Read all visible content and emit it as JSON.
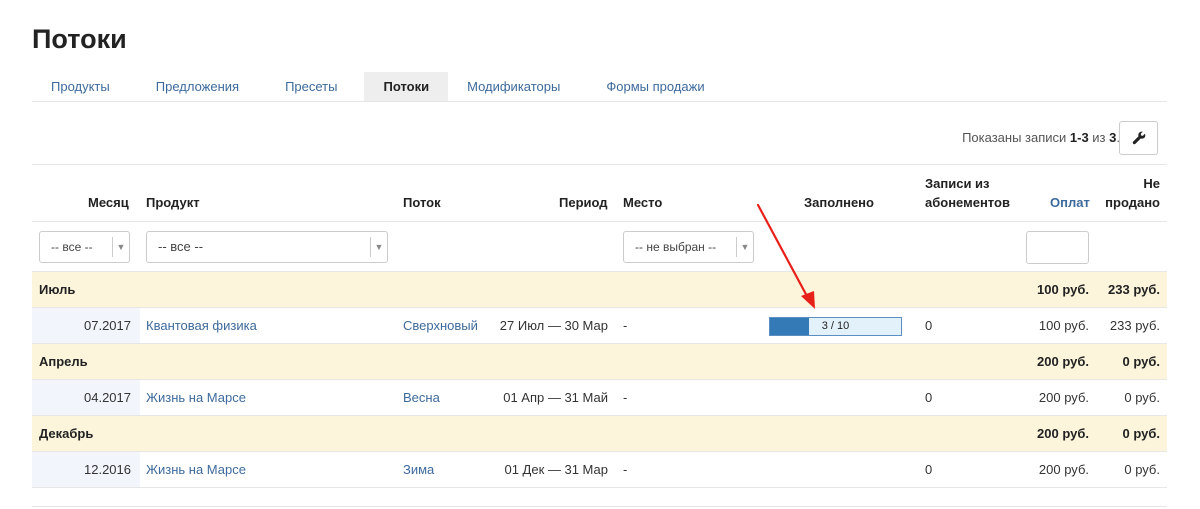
{
  "page": {
    "title": "Потоки"
  },
  "tabs": [
    {
      "label": "Продукты"
    },
    {
      "label": "Предложения"
    },
    {
      "label": "Пресеты"
    },
    {
      "label": "Потоки",
      "active": true
    },
    {
      "label": "Модификаторы"
    },
    {
      "label": "Формы продажи"
    }
  ],
  "records": {
    "prefix": "Показаны записи ",
    "range": "1-3",
    "middle": " из ",
    "total": "3",
    "suffix": "."
  },
  "toolbar": {
    "settings_icon": "wrench-icon"
  },
  "columns": {
    "month": "Месяц",
    "product": "Продукт",
    "stream": "Поток",
    "period": "Период",
    "place": "Место",
    "filled": "Заполнено",
    "subs_line1": "Записи из",
    "subs_line2": "абонементов",
    "paid": "Оплат",
    "unsold_line1": "Не",
    "unsold_line2": "продано"
  },
  "filters": {
    "month": "-- все --",
    "product": "-- все --",
    "place": "-- не выбран --",
    "unsold": ""
  },
  "groups": [
    {
      "name": "Июль",
      "paid": "100 руб.",
      "unsold": "233 руб.",
      "row": {
        "month": "07.2017",
        "product": "Квантовая физика",
        "stream": "Сверхновый",
        "period": "27 Июл — 30 Мар",
        "place": "-",
        "filled_text": "3 / 10",
        "filled_fraction": 0.3,
        "subs": "0",
        "paid": "100 руб.",
        "unsold": "233 руб."
      }
    },
    {
      "name": "Апрель",
      "paid": "200 руб.",
      "unsold": "0 руб.",
      "row": {
        "month": "04.2017",
        "product": "Жизнь на Марсе",
        "stream": "Весна",
        "period": "01 Апр — 31 Май",
        "place": "-",
        "subs": "0",
        "paid": "200 руб.",
        "unsold": "0 руб."
      }
    },
    {
      "name": "Декабрь",
      "paid": "200 руб.",
      "unsold": "0 руб.",
      "row": {
        "month": "12.2016",
        "product": "Жизнь на Марсе",
        "stream": "Зима",
        "period": "01 Дек — 31 Мар",
        "place": "-",
        "subs": "0",
        "paid": "200 руб.",
        "unsold": "0 руб."
      }
    }
  ],
  "colors": {
    "link": "#3d6a9c",
    "group_bg": "#fcf5dc",
    "progress_fill": "#337ab7",
    "annotation": "#e8201a"
  }
}
